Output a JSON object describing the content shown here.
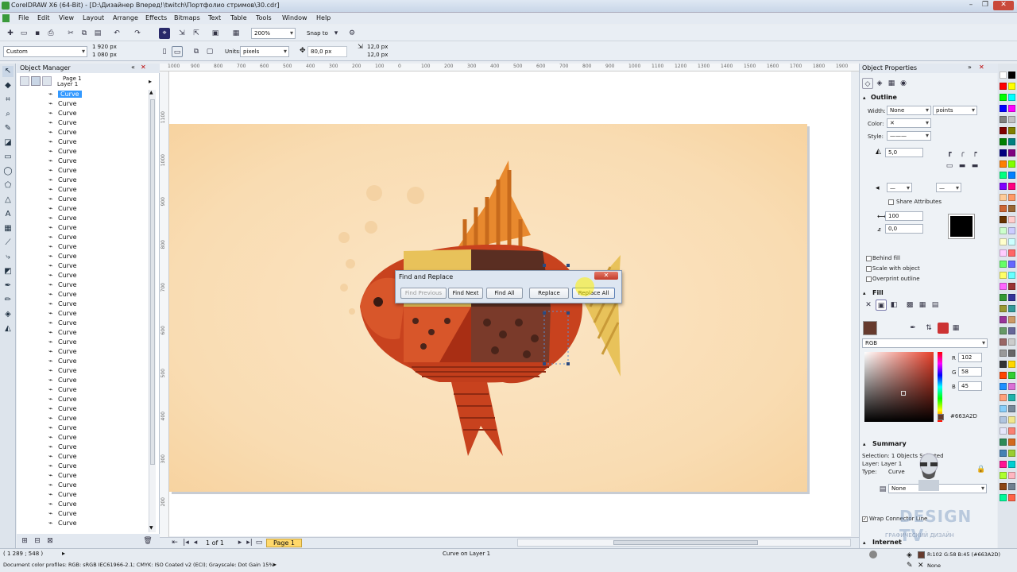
{
  "window": {
    "title": "CorelDRAW X6 (64-Bit) - [D:\\Дизайнер Вперед!\\twitch\\Портфолио стримов\\30.cdr]"
  },
  "menu": [
    "File",
    "Edit",
    "View",
    "Layout",
    "Arrange",
    "Effects",
    "Bitmaps",
    "Text",
    "Table",
    "Tools",
    "Window",
    "Help"
  ],
  "toolbar": {
    "zoom": "200%",
    "snap_label": "Snap to"
  },
  "propbar": {
    "preset": "Custom",
    "width": "1 920 px",
    "height": "1 080 px",
    "units_label": "Units:",
    "units": "pixels",
    "nudge": "80,0 px",
    "dup_x": "12,0 px",
    "dup_y": "12,0 px"
  },
  "object_manager": {
    "title": "Object Manager",
    "page": "Page 1",
    "layer": "Layer 1",
    "item_label": "Curve",
    "selected_index": 0,
    "item_count": 46
  },
  "rulers": {
    "top": [
      "1000",
      "900",
      "800",
      "700",
      "600",
      "500",
      "400",
      "300",
      "200",
      "100",
      "0",
      "100",
      "200",
      "300",
      "400",
      "500",
      "600",
      "700",
      "800",
      "900",
      "1000",
      "1100",
      "1200",
      "1300",
      "1400",
      "1500",
      "1600",
      "1700",
      "1800",
      "1900"
    ],
    "left": [
      "1100",
      "1000",
      "900",
      "800",
      "700",
      "600",
      "500",
      "400",
      "300",
      "200",
      "100"
    ]
  },
  "dialog": {
    "title": "Find and Replace",
    "buttons": [
      "Find Previous",
      "Find Next",
      "Find All",
      "Replace",
      "Replace All"
    ]
  },
  "page_nav": {
    "count": "1 of 1",
    "tab": "Page 1"
  },
  "status": {
    "coords": "( 1 289 ; 548 )",
    "object": "Curve on Layer 1",
    "color_profile": "Document color profiles: RGB: sRGB IEC61966-2.1; CMYK: ISO Coated v2 (ECI); Grayscale: Dot Gain 15%",
    "fill_readout": "R:102 G:58 B:45 (#663A2D)",
    "outline_readout": "None"
  },
  "object_properties": {
    "title": "Object Properties",
    "outline": {
      "title": "Outline",
      "width_label": "Width:",
      "width": "None",
      "units": "points",
      "color_label": "Color:",
      "style_label": "Style:",
      "miter": "5,0",
      "share_attributes": "Share Attributes",
      "stretch": "100",
      "angle": "0,0",
      "behind_fill": "Behind fill",
      "scale_with_object": "Scale with object",
      "overprint": "Overprint outline"
    },
    "fill": {
      "title": "Fill",
      "model": "RGB",
      "r_label": "R",
      "r": "102",
      "g_label": "G",
      "g": "58",
      "b_label": "B",
      "b": "45",
      "hex": "#663A2D"
    },
    "summary": {
      "title": "Summary",
      "selection": "Selection: 1 Objects Selected",
      "layer": "Layer: Layer 1",
      "type_label": "Type:",
      "type": "Curve",
      "wrap_value": "None",
      "wrap_connector": "Wrap Connector Line"
    },
    "internet": "Internet"
  },
  "watermark": {
    "brand": "DESIGN TV",
    "subtitle": "ГРАФИЧЕСКИЙ ДИЗАЙН"
  },
  "colors": {
    "accent": "#663A2D",
    "fish_orange": "#E8892E",
    "fish_red": "#C8421E",
    "fish_brown": "#5A2E22",
    "fish_yellow": "#E8C25A",
    "artboard": "#F9DCB2"
  },
  "palette": [
    "#ffffff",
    "#000000",
    "#ff0000",
    "#ffff00",
    "#00ff00",
    "#00ffff",
    "#0000ff",
    "#ff00ff",
    "#808080",
    "#c0c0c0",
    "#800000",
    "#808000",
    "#008000",
    "#008080",
    "#000080",
    "#800080",
    "#ff8000",
    "#80ff00",
    "#00ff80",
    "#0080ff",
    "#8000ff",
    "#ff0080",
    "#ffcc99",
    "#ff9966",
    "#cc6633",
    "#996633",
    "#663300",
    "#ffcccc",
    "#ccffcc",
    "#ccccff",
    "#ffffcc",
    "#ccffff",
    "#ffccff",
    "#ff6666",
    "#66ff66",
    "#6666ff",
    "#ffff66",
    "#66ffff",
    "#ff66ff",
    "#993333",
    "#339933",
    "#333399",
    "#999933",
    "#339999",
    "#993399",
    "#cc9966",
    "#669966",
    "#666699",
    "#996666",
    "#cccccc",
    "#999999",
    "#666666",
    "#333333",
    "#ffd700",
    "#ff4500",
    "#32cd32",
    "#1e90ff",
    "#da70d6",
    "#ffa07a",
    "#20b2aa",
    "#87cefa",
    "#778899",
    "#b0c4de",
    "#f0e68c",
    "#e6e6fa",
    "#fa8072",
    "#2e8b57",
    "#d2691e",
    "#4682b4",
    "#9acd32",
    "#ff1493",
    "#00ced1",
    "#adff2f",
    "#ffb6c1",
    "#8b4513",
    "#708090",
    "#00fa9a",
    "#ff6347"
  ]
}
